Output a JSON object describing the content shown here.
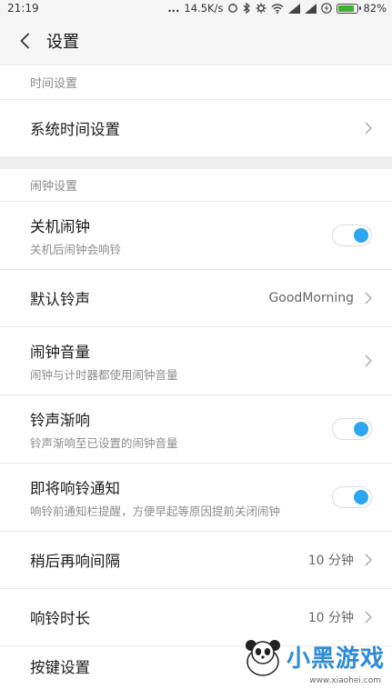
{
  "status_bar": {
    "time": "21:19",
    "dots": "...",
    "speed": "14.5K/s",
    "battery_pct": "82%",
    "battery_level": 0.82,
    "icons": [
      "sync-icon",
      "bluetooth-icon",
      "settings-gear-icon",
      "wifi-icon",
      "signal-icon",
      "signal-icon",
      "charging-icon",
      "battery-icon"
    ]
  },
  "header": {
    "title": "设置"
  },
  "sections": {
    "time": {
      "header": "时间设置",
      "system_time": {
        "title": "系统时间设置"
      }
    },
    "alarm": {
      "header": "闹钟设置",
      "power_off_alarm": {
        "title": "关机闹钟",
        "subtitle": "关机后闹钟会响铃",
        "on": true
      },
      "default_ringtone": {
        "title": "默认铃声",
        "value": "GoodMorning"
      },
      "alarm_volume": {
        "title": "闹钟音量",
        "subtitle": "闹钟与计时器都使用闹钟音量"
      },
      "ringtone_crescendo": {
        "title": "铃声渐响",
        "subtitle": "铃声渐响至已设置的闹钟音量",
        "on": true
      },
      "upcoming_notice": {
        "title": "即将响铃通知",
        "subtitle": "响铃前通知栏提醒，方便早起等原因提前关闭闹钟",
        "on": true
      },
      "snooze_interval": {
        "title": "稍后再响间隔",
        "value": "10 分钟"
      },
      "ring_duration": {
        "title": "响铃时长",
        "value": "10 分钟"
      },
      "button_settings": {
        "title": "按键设置"
      }
    }
  },
  "watermark": {
    "text": "小黑游戏",
    "url": "www.xiaohei.com"
  },
  "colors": {
    "accent": "#2ba6f0",
    "background": "#f5f5f5"
  }
}
